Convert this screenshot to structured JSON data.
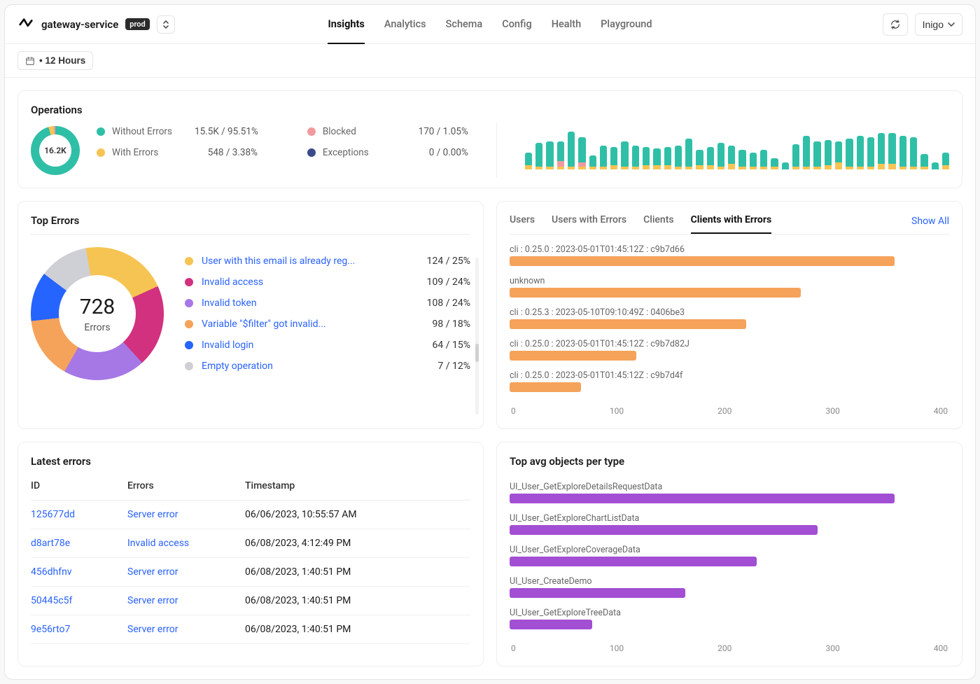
{
  "header": {
    "service_name": "gateway-service",
    "env_badge": "prod",
    "nav": [
      "Insights",
      "Analytics",
      "Schema",
      "Config",
      "Health",
      "Playground"
    ],
    "active_nav_index": 0,
    "user_label": "Inigo"
  },
  "timerange": {
    "label": "• 12 Hours"
  },
  "operations": {
    "title": "Operations",
    "total_label": "16.2K",
    "legend": [
      {
        "label": "Without Errors",
        "value": "15.5K / 95.51%",
        "color": "#2fbfa7"
      },
      {
        "label": "With Errors",
        "value": "548 / 3.38%",
        "color": "#f6c453"
      },
      {
        "label": "Blocked",
        "value": "170 / 1.05%",
        "color": "#f09a9f"
      },
      {
        "label": "Exceptions",
        "value": "0 / 0.00%",
        "color": "#3b4a8a"
      }
    ],
    "donut_gradient": "conic-gradient(#2fbfa7 0 95.5%, #f6c453 95.5% 98.9%, #f09a9f 98.9% 100%)"
  },
  "chart_data": {
    "operations_histogram": {
      "type": "bar",
      "stacked": true,
      "categories_count": 40,
      "series": [
        {
          "name": "Without Errors",
          "color": "#2fbfa7"
        },
        {
          "name": "With Errors",
          "color": "#f6c453"
        },
        {
          "name": "Blocked",
          "color": "#f09a9f"
        }
      ],
      "bars": [
        {
          "a": 18,
          "b": 6,
          "c": 0
        },
        {
          "a": 34,
          "b": 4,
          "c": 0
        },
        {
          "a": 36,
          "b": 4,
          "c": 0
        },
        {
          "a": 28,
          "b": 4,
          "c": 8
        },
        {
          "a": 50,
          "b": 4,
          "c": 0
        },
        {
          "a": 36,
          "b": 4,
          "c": 6
        },
        {
          "a": 16,
          "b": 4,
          "c": 0
        },
        {
          "a": 30,
          "b": 4,
          "c": 0
        },
        {
          "a": 26,
          "b": 6,
          "c": 0
        },
        {
          "a": 36,
          "b": 4,
          "c": 0
        },
        {
          "a": 30,
          "b": 4,
          "c": 0
        },
        {
          "a": 26,
          "b": 6,
          "c": 0
        },
        {
          "a": 24,
          "b": 6,
          "c": 0
        },
        {
          "a": 26,
          "b": 6,
          "c": 0
        },
        {
          "a": 30,
          "b": 4,
          "c": 0
        },
        {
          "a": 40,
          "b": 4,
          "c": 0
        },
        {
          "a": 22,
          "b": 6,
          "c": 0
        },
        {
          "a": 26,
          "b": 6,
          "c": 0
        },
        {
          "a": 34,
          "b": 4,
          "c": 0
        },
        {
          "a": 26,
          "b": 8,
          "c": 0
        },
        {
          "a": 24,
          "b": 4,
          "c": 0
        },
        {
          "a": 20,
          "b": 4,
          "c": 0
        },
        {
          "a": 24,
          "b": 4,
          "c": 0
        },
        {
          "a": 12,
          "b": 4,
          "c": 0
        },
        {
          "a": 10,
          "b": 0,
          "c": 0
        },
        {
          "a": 32,
          "b": 4,
          "c": 0
        },
        {
          "a": 44,
          "b": 4,
          "c": 0
        },
        {
          "a": 36,
          "b": 4,
          "c": 0
        },
        {
          "a": 36,
          "b": 6,
          "c": 0
        },
        {
          "a": 30,
          "b": 10,
          "c": 0
        },
        {
          "a": 40,
          "b": 4,
          "c": 0
        },
        {
          "a": 44,
          "b": 4,
          "c": 0
        },
        {
          "a": 42,
          "b": 4,
          "c": 0
        },
        {
          "a": 44,
          "b": 8,
          "c": 0
        },
        {
          "a": 44,
          "b": 8,
          "c": 0
        },
        {
          "a": 44,
          "b": 4,
          "c": 0
        },
        {
          "a": 42,
          "b": 4,
          "c": 0
        },
        {
          "a": 18,
          "b": 4,
          "c": 0
        },
        {
          "a": 10,
          "b": 0,
          "c": 0
        },
        {
          "a": 18,
          "b": 6,
          "c": 0
        }
      ]
    },
    "top_errors_donut": {
      "type": "pie",
      "values_pct": [
        25,
        24,
        24,
        18,
        15,
        12
      ],
      "labels": [
        "User with this email is already reg…",
        "Invalid access",
        "Invalid token",
        "Variable \"$filter\" got invalid…",
        "Invalid login",
        "Empty operation"
      ]
    },
    "clients_with_errors": {
      "type": "bar",
      "orientation": "horizontal",
      "xlim": [
        0,
        400
      ],
      "xticks": [
        0,
        100,
        200,
        300,
        400
      ],
      "items": [
        {
          "label": "cli : 0.25.0 : 2023-05-01T01:45:12Z : c9b7d66",
          "value": 350
        },
        {
          "label": "unknown",
          "value": 265
        },
        {
          "label": "cli : 0.25.3 : 2023-05-10T09:10:49Z : 0406be3",
          "value": 215
        },
        {
          "label": "cli : 0.25.0 : 2023-05-01T01:45:12Z : c9b7d82J",
          "value": 115
        },
        {
          "label": "cli : 0.25.0 : 2023-05-01T01:45:12Z : c9b7d4f",
          "value": 65
        }
      ],
      "color": "#f5a35b"
    },
    "top_avg_objects": {
      "type": "bar",
      "orientation": "horizontal",
      "xlim": [
        0,
        400
      ],
      "xticks": [
        0,
        100,
        200,
        300,
        400
      ],
      "items": [
        {
          "label": "UI_User_GetExploreDetailsRequestData",
          "value": 350
        },
        {
          "label": "UI_User_GetExploreChartListData",
          "value": 280
        },
        {
          "label": "UI_User_GetExploreCoverageData",
          "value": 225
        },
        {
          "label": "UI_User_CreateDemo",
          "value": 160
        },
        {
          "label": "UI_User_GetExploreTreeData",
          "value": 75
        }
      ],
      "color": "#a24fd3"
    }
  },
  "top_errors": {
    "title": "Top Errors",
    "center_number": "728",
    "center_label": "Errors",
    "donut_gradient": "conic-gradient(from -10deg, #f6c453 0 21%, #d1317e 21% 41%, #a678e6 41% 61%, #f5a35b 61% 76%, #2664ff 76% 88%, #cfcfd6 88% 100%)",
    "items": [
      {
        "color": "#f6c453",
        "name": "User with this email is already reg...",
        "value": "124 / 25%"
      },
      {
        "color": "#d1317e",
        "name": "Invalid access",
        "value": "109 / 24%"
      },
      {
        "color": "#a678e6",
        "name": "Invalid token",
        "value": "108 / 24%"
      },
      {
        "color": "#f5a35b",
        "name": "Variable \"$filter\" got invalid...",
        "value": "98 / 18%"
      },
      {
        "color": "#2664ff",
        "name": "Invalid login",
        "value": "64 / 15%"
      },
      {
        "color": "#cfcfd6",
        "name": "Empty operation",
        "value": "7 / 12%"
      }
    ]
  },
  "clients_panel": {
    "tabs": [
      "Users",
      "Users with Errors",
      "Clients",
      "Clients with Errors"
    ],
    "active_tab_index": 3,
    "show_all": "Show All"
  },
  "latest_errors": {
    "title": "Latest errors",
    "columns": [
      "ID",
      "Errors",
      "Timestamp"
    ],
    "rows": [
      {
        "id": "125677dd",
        "error": "Server error",
        "ts": "06/06/2023, 10:55:57 AM"
      },
      {
        "id": "d8art78e",
        "error": "Invalid access",
        "ts": "06/08/2023, 4:12:49 PM"
      },
      {
        "id": "456dhfnv",
        "error": "Server error",
        "ts": "06/08/2023, 1:40:51 PM"
      },
      {
        "id": "50445c5f",
        "error": "Server error",
        "ts": "06/08/2023, 1:40:51 PM"
      },
      {
        "id": "9e56rto7",
        "error": "Server error",
        "ts": "06/08/2023, 1:40:51 PM"
      }
    ]
  },
  "top_avg": {
    "title": "Top avg objects per type"
  }
}
